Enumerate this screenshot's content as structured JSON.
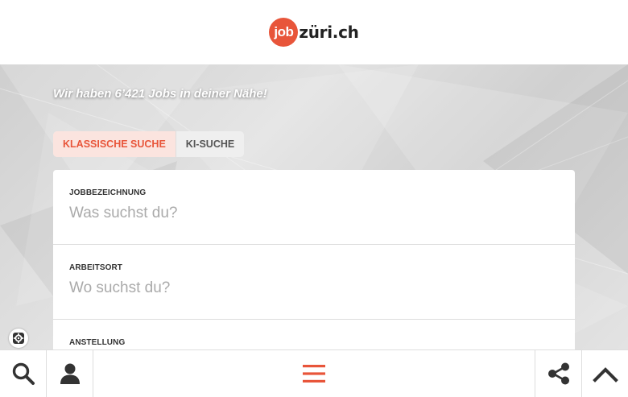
{
  "header": {
    "logo_circle_text": "job",
    "logo_text": "züri.ch"
  },
  "hero": {
    "jobs_count_text": "Wir haben 6’421 Jobs in deiner Nähe!"
  },
  "tabs": [
    {
      "label": "KLASSISCHE SUCHE",
      "active": true
    },
    {
      "label": "KI-SUCHE",
      "active": false
    }
  ],
  "form": {
    "job_title": {
      "label": "JOBBEZEICHNUNG",
      "placeholder": "Was suchst du?"
    },
    "location": {
      "label": "ARBEITSORT",
      "placeholder": "Wo suchst du?"
    },
    "employment": {
      "label": "ANSTELLUNG"
    }
  },
  "bottom_bar": {
    "icons": [
      "search-icon",
      "user-icon",
      "hamburger-menu-icon",
      "share-icon",
      "chevron-up-icon"
    ]
  },
  "colors": {
    "brand": "#e8553a",
    "tab_active_bg": "#fbe4df",
    "icon_dark": "#333333"
  }
}
